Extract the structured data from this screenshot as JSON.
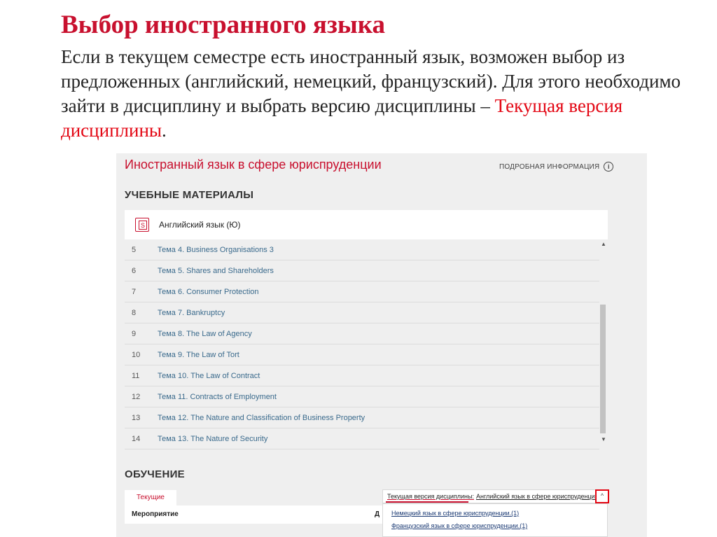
{
  "slide": {
    "title": "Выбор иностранного языка",
    "body_text": "Если в текущем семестре есть иностранный язык, возможен выбор из предложенных (английский, немецкий, французский). Для этого необходимо зайти в дисциплину и выбрать версию дисциплины – ",
    "body_highlight": "Текущая версия дисциплины",
    "body_end": "."
  },
  "course": {
    "title": "Иностранный язык в сфере юриспруденции",
    "more_info": "ПОДРОБНАЯ ИНФОРМАЦИЯ",
    "info_icon": "i"
  },
  "materials": {
    "section_title": "УЧЕБНЫЕ МАТЕРИАЛЫ",
    "card_icon_letter": "S",
    "card_name": "Английский язык (Ю)",
    "topics": [
      {
        "num": "5",
        "name": "Тема 4. Business Organisations 3"
      },
      {
        "num": "6",
        "name": "Тема 5. Shares and Shareholders"
      },
      {
        "num": "7",
        "name": "Тема 6. Consumer Protection"
      },
      {
        "num": "8",
        "name": "Тема 7. Bankruptcy"
      },
      {
        "num": "9",
        "name": "Тема 8. The Law of Agency"
      },
      {
        "num": "10",
        "name": "Тема 9. The Law of Tort"
      },
      {
        "num": "11",
        "name": "Тема 10. The Law of Contract"
      },
      {
        "num": "12",
        "name": "Тема 11. Contracts of Employment"
      },
      {
        "num": "13",
        "name": "Тема 12. The Nature and Classification of Business Property"
      },
      {
        "num": "14",
        "name": "Тема 13. The Nature of Security"
      }
    ]
  },
  "training": {
    "section_title": "ОБУЧЕНИЕ",
    "tab_current": "Текущие",
    "col_event": "Мероприятие",
    "col_second": "Д",
    "version_label": "Текущая версия дисциплины:",
    "version_value": "Английский язык в сфере юриспруденции",
    "dropdown_icon": "^",
    "options": [
      "Немецкий язык в сфере юриспруденции.(1)",
      "Французский язык в сфере юриспруденции.(1)"
    ]
  }
}
